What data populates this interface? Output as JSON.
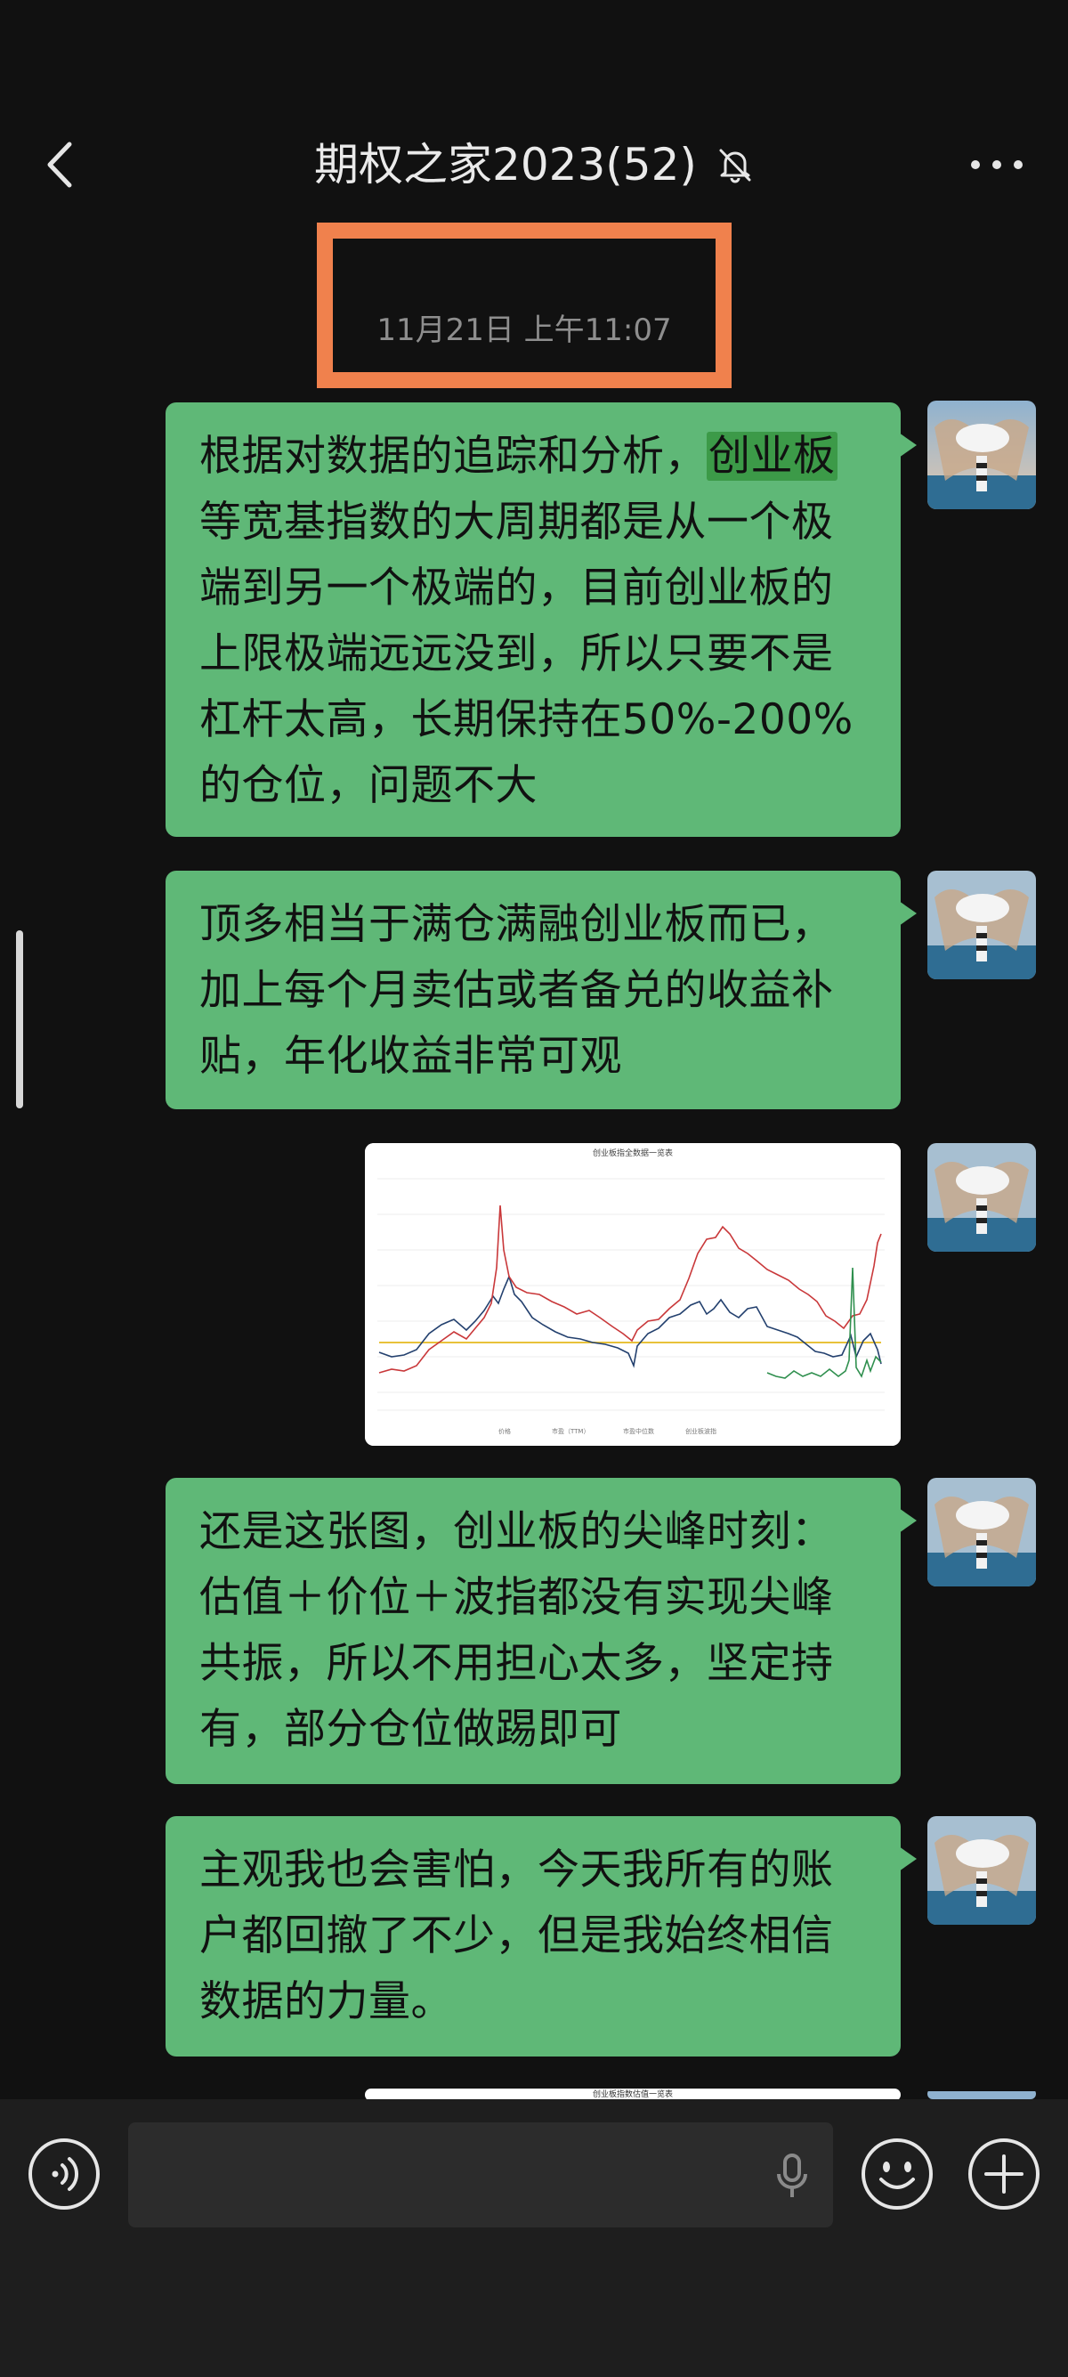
{
  "header": {
    "title": "期权之家2023(52)",
    "back_icon": "chevron-left-icon",
    "mute_icon": "bell-off-icon",
    "more_icon": "more-dots-icon"
  },
  "timestamp": "11月21日 上午11:07",
  "messages": [
    {
      "lines": [
        "根据对数据的追踪和分析，",
        "等宽基指数的大周期都是从一个极",
        "端到另一个极端的，目前创业板的",
        "上限极端远远没到，所以只要不是",
        "杠杆太高，长期保持在50%-200%",
        "的仓位，问题不大"
      ],
      "highlight": "创业板"
    },
    {
      "lines": [
        "顶多相当于满仓满融创业板而已，",
        "加上每个月卖估或者备兑的收益补",
        "贴，年化收益非常可观"
      ]
    },
    {
      "lines": [
        "还是这张图，创业板的尖峰时刻：",
        "估值＋价位＋波指都没有实现尖峰",
        "共振，所以不用担心太多，坚定持",
        "有，部分仓位做踢即可"
      ]
    },
    {
      "lines": [
        "主观我也会害怕，今天我所有的账",
        "户都回撤了不少，但是我始终相信",
        "数据的力量。"
      ]
    }
  ],
  "chart_image": {
    "title": "创业板指全数据一览表",
    "legend": [
      "价格",
      "市盈（TTM）",
      "市盈中位数",
      "创业板波指"
    ],
    "colors": {
      "price": "#23406e",
      "pe": "#c9383a",
      "median": "#e8c23a",
      "vol": "#2f8f4e"
    }
  },
  "partial_image_title": "创业板指数估值一览表",
  "composer": {
    "placeholder": "",
    "voice_icon": "voice-toggle-icon",
    "mic_icon": "microphone-icon",
    "emoji_icon": "emoji-icon",
    "plus_icon": "plus-icon"
  },
  "colors": {
    "bubble": "#5fb877",
    "background": "#111111",
    "highlight_frame": "#f0814d"
  }
}
